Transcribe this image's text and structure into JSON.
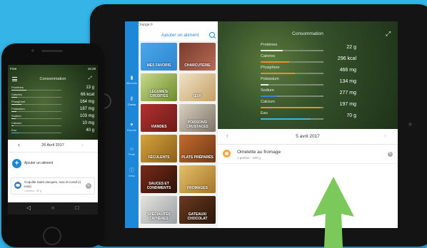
{
  "tablet": {
    "status": "Orange F",
    "header_title": "Ajouter un aliment",
    "rail": [
      {
        "label": "Aliments"
      },
      {
        "label": "Conso",
        "active": true
      },
      {
        "label": "Favoris"
      },
      {
        "label": "Profil"
      },
      {
        "label": "Infos"
      }
    ],
    "tiles": [
      {
        "label": "MES FAVORIS",
        "colors": [
          "#4aa7ea",
          "#2f86d0"
        ]
      },
      {
        "label": "CHARCUTERIE",
        "colors": [
          "#7a3b2c",
          "#b76b55"
        ]
      },
      {
        "label": "LÉGUMES/ CRUDITÉS",
        "colors": [
          "#c9d98a",
          "#6d8c2e"
        ]
      },
      {
        "label": "ŒUF",
        "colors": [
          "#efe2c6",
          "#c79f66"
        ]
      },
      {
        "label": "VIANDES",
        "colors": [
          "#b2312e",
          "#6e1a18"
        ]
      },
      {
        "label": "POISSONS/ CRUSTACÉS",
        "colors": [
          "#d9d0c1",
          "#7f7467"
        ]
      },
      {
        "label": "FÉCULENTS",
        "colors": [
          "#d5a53c",
          "#8b5e1a"
        ]
      },
      {
        "label": "PLATS PRÉPARÉS",
        "colors": [
          "#c46b2c",
          "#6f3a18"
        ]
      },
      {
        "label": "SAUCES ET CONDIMENTS",
        "colors": [
          "#7a2a1b",
          "#2c1208"
        ]
      },
      {
        "label": "FROMAGES",
        "colors": [
          "#e5c06a",
          "#a3762a"
        ]
      },
      {
        "label": "SPÉCIALITÉS LAITIÈRES",
        "colors": [
          "#e6e4dd",
          "#9aa0a4"
        ]
      },
      {
        "label": "GATEAUX/ CHOCOLAT",
        "colors": [
          "#6b3a1f",
          "#2a160a"
        ]
      }
    ],
    "consommation": {
      "title": "Consommation",
      "nutrients": [
        {
          "label": "Protéines",
          "value": "22 g",
          "fill": 0.35,
          "color": "#e6efe0"
        },
        {
          "label": "Calories",
          "value": "296 kcal",
          "fill": 0.45,
          "color": "#f08c2c"
        },
        {
          "label": "Phosphore",
          "value": "466 mg",
          "fill": 0.55,
          "color": "#f08c2c"
        },
        {
          "label": "Potassium",
          "value": "134 mg",
          "fill": 0.12,
          "color": "#e6efe0"
        },
        {
          "label": "Sodium",
          "value": "277 mg",
          "fill": 0.25,
          "color": "#3b82d6"
        },
        {
          "label": "Calcium",
          "value": "197 mg",
          "fill": 0.95,
          "color": "#f08c2c"
        },
        {
          "label": "Eau",
          "value": "70 g",
          "fill": 0.8,
          "color": "#3fb8e0"
        }
      ]
    },
    "date": "5 avril 2017",
    "meal": {
      "name": "Omelette au fromage",
      "sub": "1 portion - 100 g"
    }
  },
  "phone": {
    "status_left": "Free",
    "status_right": "15:29",
    "title": "Consommation",
    "nutrients": [
      {
        "label": "Protéines",
        "value": "13 g",
        "fill": 0.3,
        "color": "#e6efe0"
      },
      {
        "label": "Calories",
        "value": "66 kcal",
        "fill": 0.12,
        "color": "#e6efe0"
      },
      {
        "label": "Phosphore",
        "value": "164 mg",
        "fill": 0.2,
        "color": "#e6efe0"
      },
      {
        "label": "Potassium",
        "value": "187 mg",
        "fill": 0.1,
        "color": "#e6efe0"
      },
      {
        "label": "Sodium",
        "value": "103 mg",
        "fill": 0.08,
        "color": "#e6efe0"
      },
      {
        "label": "Calcium",
        "value": "10 mg",
        "fill": 0.04,
        "color": "#e6efe0"
      },
      {
        "label": "Eau",
        "value": "40 g",
        "fill": 0.15,
        "color": "#3fb8e0"
      }
    ],
    "date": "26 Avril 2017",
    "add_label": "Ajouter un aliment",
    "meal": {
      "name": "Coquille Saint-Jacques, noix et corail (4 noix)",
      "sub": "1 portion - 30 g"
    }
  }
}
